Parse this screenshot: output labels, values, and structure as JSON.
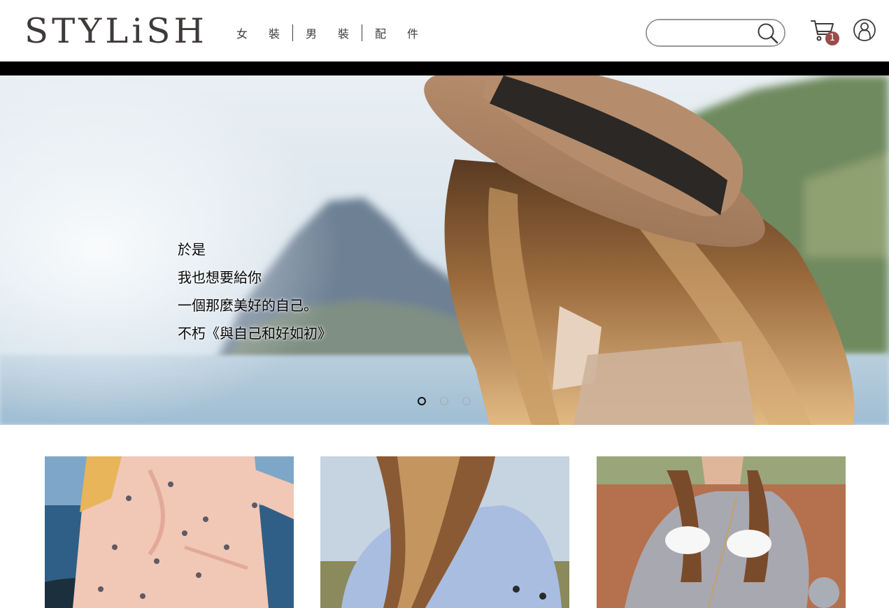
{
  "header": {
    "logo_text": "STYLiSH",
    "nav": [
      {
        "label": "女裝"
      },
      {
        "label": "男裝"
      },
      {
        "label": "配件"
      }
    ],
    "search": {
      "value": "",
      "placeholder": "",
      "icon": "search-icon"
    },
    "cart": {
      "icon": "cart-icon",
      "count": "1"
    },
    "member": {
      "icon": "member-icon"
    }
  },
  "hero": {
    "story_lines": [
      "於是",
      "我也想要給你",
      "一個那麼美好的自己。",
      "不朽《與自己和好如初》"
    ],
    "carousel": {
      "count": 3,
      "active_index": 0
    }
  },
  "colors": {
    "text": "#3f3a3a",
    "bar": "#000000",
    "badge": "#9b4b4b"
  }
}
